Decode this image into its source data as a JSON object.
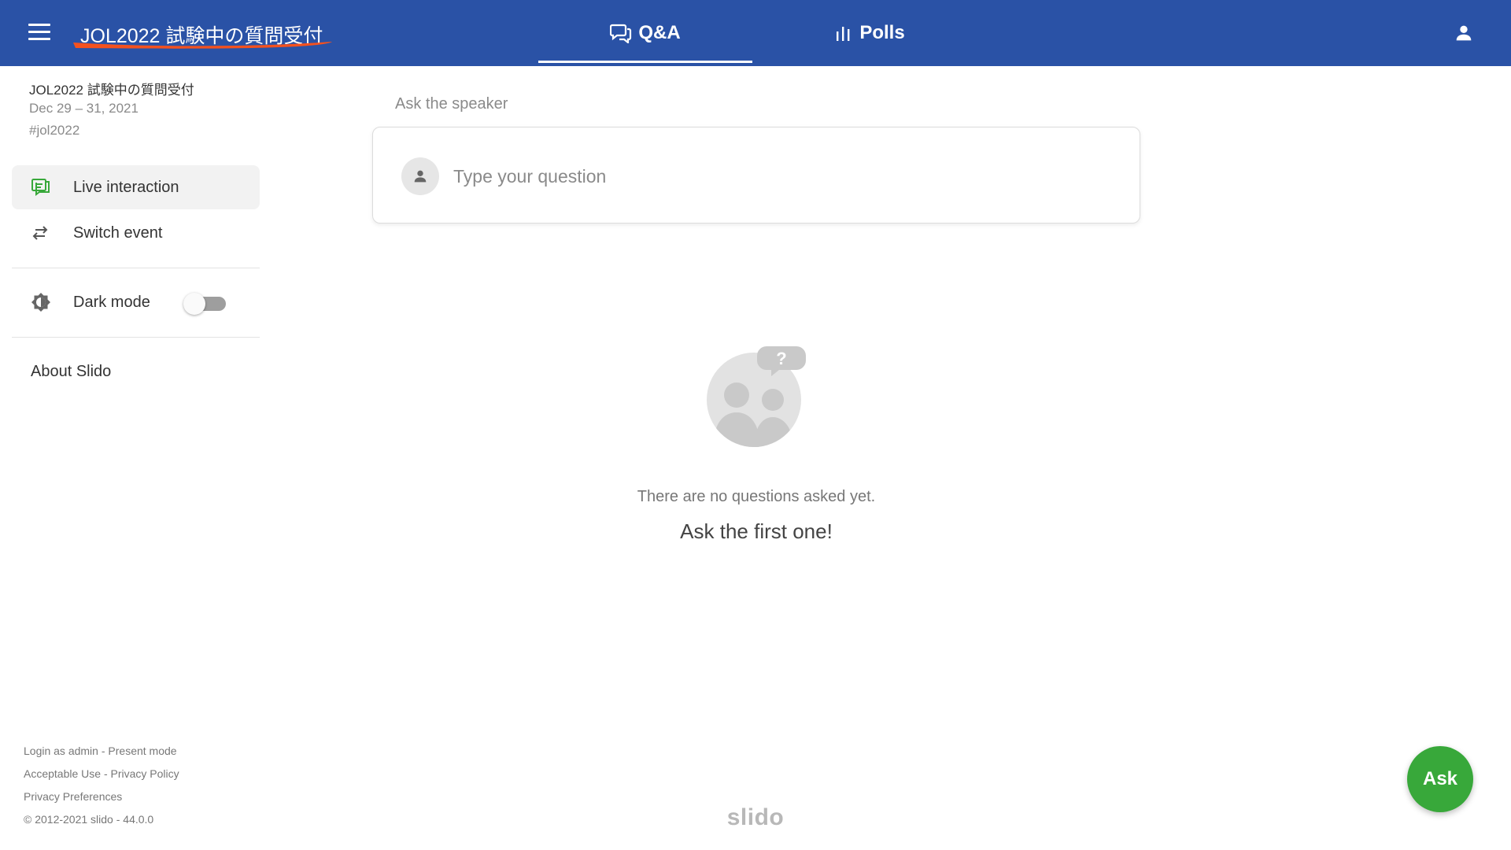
{
  "header": {
    "event_title": "JOL2022 試験中の質問受付",
    "tabs": [
      {
        "label": "Q&A",
        "icon": "chat-bubbles-icon",
        "active": true
      },
      {
        "label": "Polls",
        "icon": "bar-chart-icon",
        "active": false
      }
    ],
    "menu_icon": "hamburger-menu-icon",
    "user_icon": "person-icon",
    "bar_color": "#2a52a6",
    "annotation_color": "#f4511e"
  },
  "sidebar": {
    "event_name": "JOL2022 試験中の質問受付",
    "event_dates": "Dec 29 – 31, 2021",
    "event_hashtag": "#jol2022",
    "items": [
      {
        "label": "Live interaction",
        "icon": "live-interaction-icon",
        "active": true
      },
      {
        "label": "Switch event",
        "icon": "switch-arrows-icon",
        "active": false
      }
    ],
    "dark_mode": {
      "label": "Dark mode",
      "icon": "brightness-icon",
      "enabled": false
    },
    "about_label": "About Slido",
    "footer": {
      "login_as_admin": "Login as admin",
      "present_mode": "Present mode",
      "acceptable_use": "Acceptable Use",
      "privacy_policy": "Privacy Policy",
      "privacy_preferences": "Privacy Preferences",
      "separator": " - ",
      "copyright": "© 2012-2021 slido - 44.0.0"
    }
  },
  "main": {
    "ask_speaker_label": "Ask the speaker",
    "question_placeholder": "Type your question",
    "empty_state_text": "There are no questions asked yet.",
    "empty_state_cta": "Ask the first one!",
    "empty_state_icon": "people-question-icon",
    "brand_logo_text": "slido",
    "ask_button_label": "Ask",
    "accent_color": "#38a83a"
  }
}
